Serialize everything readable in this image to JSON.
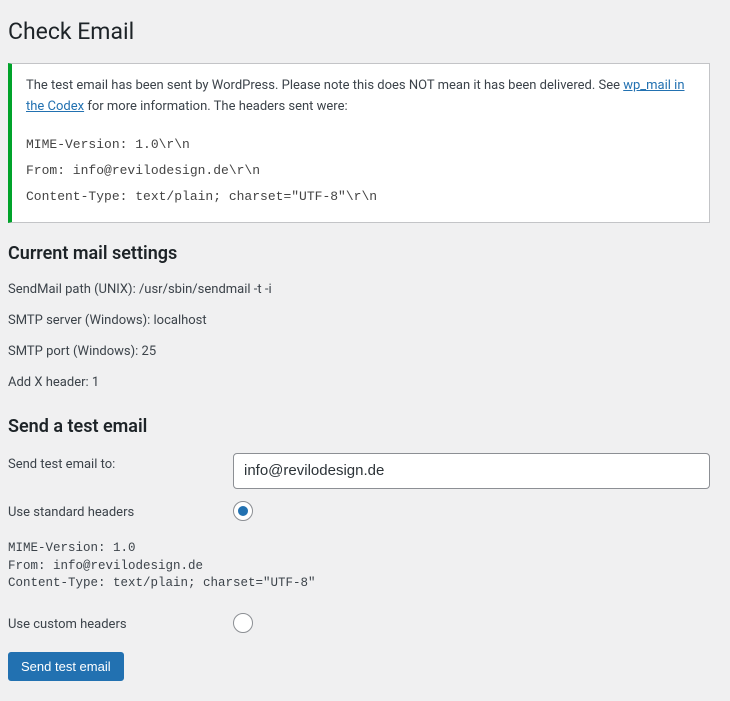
{
  "page_title": "Check Email",
  "notice": {
    "message_prefix": "The test email has been sent by WordPress. Please note this does NOT mean it has been delivered. See ",
    "link_text": "wp_mail in the Codex",
    "message_suffix": " for more information. The headers sent were:",
    "headers": "MIME-Version: 1.0\\r\\n\nFrom: info@revilodesign.de\\r\\n\nContent-Type: text/plain; charset=\"UTF-8\"\\r\\n"
  },
  "settings": {
    "heading": "Current mail settings",
    "rows": [
      "SendMail path (UNIX): /usr/sbin/sendmail -t -i",
      "SMTP server (Windows): localhost",
      "SMTP port (Windows): 25",
      "Add X header: 1"
    ]
  },
  "test": {
    "heading": "Send a test email",
    "send_to_label": "Send test email to:",
    "send_to_value": "info@revilodesign.de",
    "standard_headers_label": "Use standard headers",
    "standard_headers_preview": "MIME-Version: 1.0\nFrom: info@revilodesign.de\nContent-Type: text/plain; charset=\"UTF-8\"",
    "custom_headers_label": "Use custom headers",
    "submit_label": "Send test email"
  }
}
